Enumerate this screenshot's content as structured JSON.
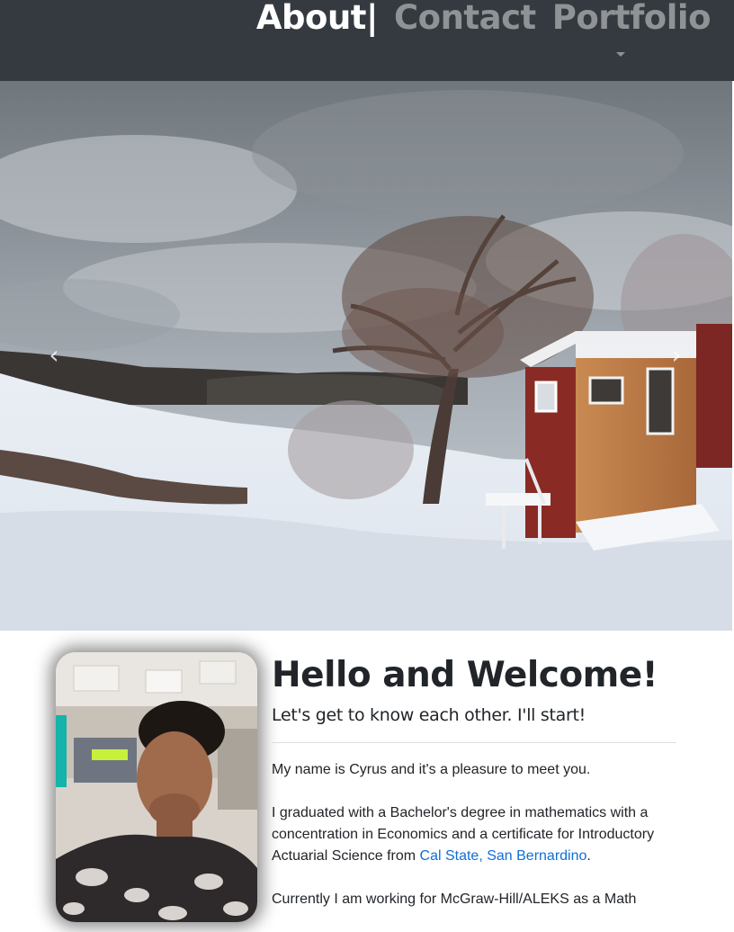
{
  "nav": {
    "about_label": "About|",
    "contact_label": "Contact",
    "portfolio_label": "Portfolio"
  },
  "carousel": {
    "prev_symbol": "‹",
    "next_symbol": "›"
  },
  "intro": {
    "heading": "Hello and Welcome!",
    "lead": "Let's get to know each other. I'll start!",
    "para1": "My name is Cyrus and it's a pleasure to meet you.",
    "para2_before": "I graduated with a Bachelor's degree in mathematics with a concentration in Economics and a certificate for Introductory Actuarial Science from ",
    "para2_link": "Cal State, San Bernardino",
    "para2_after": ".",
    "para3": "Currently I am working for McGraw-Hill/ALEKS as a Math"
  },
  "colors": {
    "navbar_bg": "#343a40",
    "nav_active": "#ffffff",
    "nav_inactive": "#8f9396",
    "link": "#0f6fd8"
  }
}
